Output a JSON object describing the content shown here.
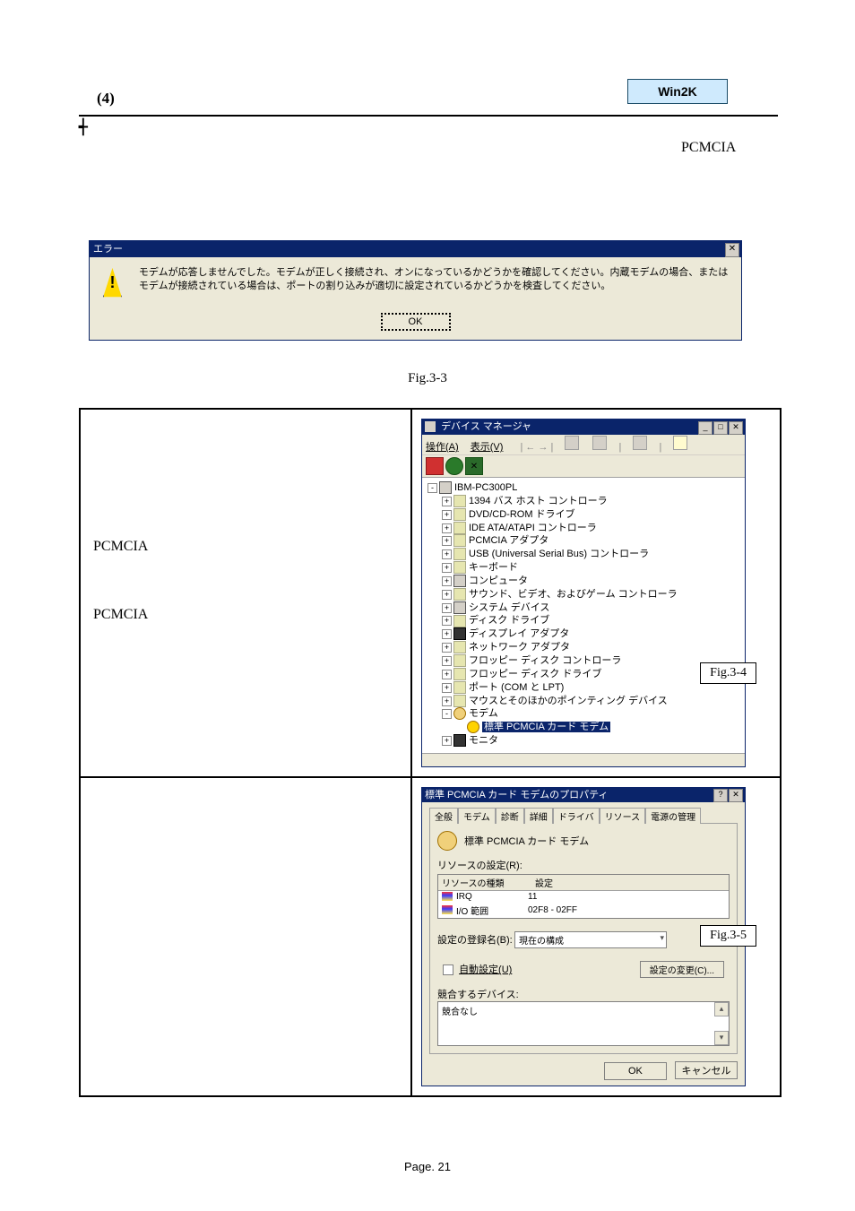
{
  "header": {
    "step_number": "(4)",
    "badge": "Win2K",
    "right_label": "PCMCIA"
  },
  "error_dialog": {
    "title": "エラー",
    "message": "モデムが応答しませんでした。モデムが正しく接続され、オンになっているかどうかを確認してください。内蔵モデムの場合、またはモデムが接続されている場合は、ポートの割り込みが適切に設定されているかどうかを検査してください。",
    "ok_label": "OK"
  },
  "fig33_caption": "Fig.3-3",
  "left_col": {
    "pcmcia1": "PCMCIA",
    "pcmcia2": "PCMCIA"
  },
  "device_manager": {
    "title": "デバイス マネージャ",
    "menu": {
      "action": "操作(A)",
      "view": "表示(V)"
    },
    "root": "IBM-PC300PL",
    "nodes": [
      "1394 バス ホスト コントローラ",
      "DVD/CD-ROM ドライブ",
      "IDE ATA/ATAPI コントローラ",
      "PCMCIA アダプタ",
      "USB (Universal Serial Bus) コントローラ",
      "キーボード",
      "コンピュータ",
      "サウンド、ビデオ、およびゲーム コントローラ",
      "システム デバイス",
      "ディスク ドライブ",
      "ディスプレイ アダプタ",
      "ネットワーク アダプタ",
      "フロッピー ディスク コントローラ",
      "フロッピー ディスク ドライブ",
      "ポート (COM と LPT)",
      "マウスとそのほかのポインティング デバイス"
    ],
    "modem_label": "モデム",
    "modem_child": "標準 PCMCIA カード モデム",
    "monitor_label": "モニタ",
    "fig_caption": "Fig.3-4"
  },
  "properties": {
    "title": "標準 PCMCIA カード モデムのプロパティ",
    "tabs": [
      "全般",
      "モデム",
      "診断",
      "詳細",
      "ドライバ",
      "リソース",
      "電源の管理"
    ],
    "device_name": "標準 PCMCIA カード モデム",
    "resource_settings_label": "リソースの設定(R):",
    "col_type": "リソースの種類",
    "col_setting": "設定",
    "irq_label": "IRQ",
    "irq_value": "11",
    "io_label": "I/O 範囲",
    "io_value": "02F8 - 02FF",
    "config_label": "設定の登録名(B):",
    "config_value": "現在の構成",
    "auto_label": "自動設定(U)",
    "change_btn": "設定の変更(C)...",
    "conflict_label": "競合するデバイス:",
    "conflict_value": "競合なし",
    "ok": "OK",
    "cancel": "キャンセル",
    "fig_caption": "Fig.3-5"
  },
  "page_number": "Page. 21"
}
